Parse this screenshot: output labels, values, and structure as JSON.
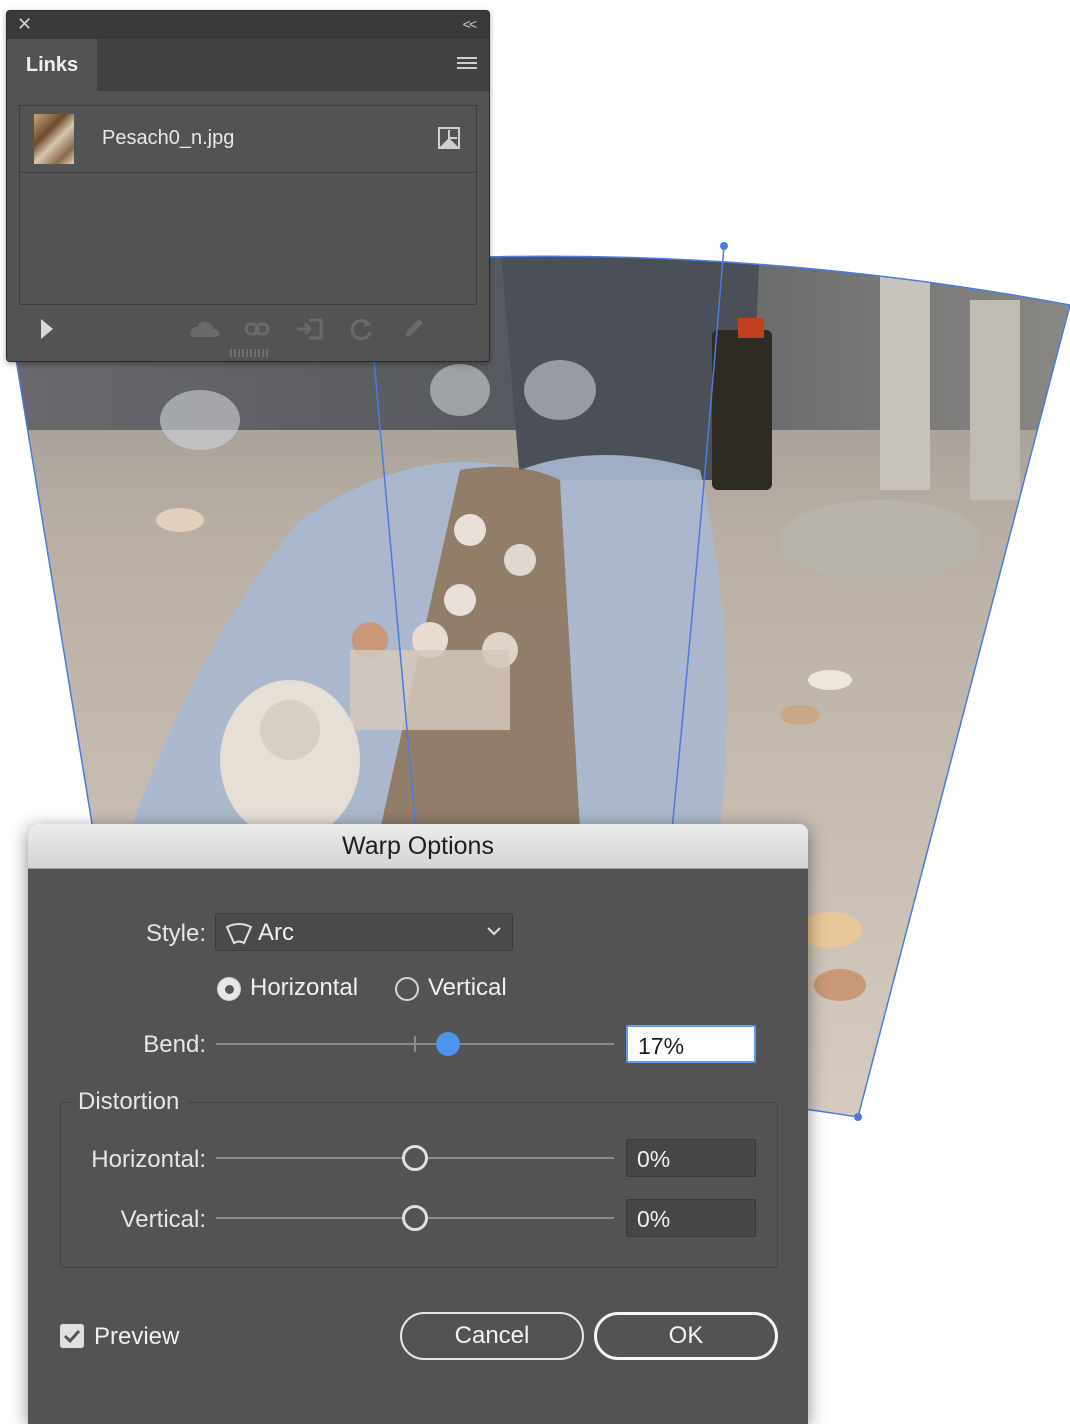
{
  "links_panel": {
    "close_glyph": "✕",
    "collapse_glyph": "<<",
    "tab_label": "Links",
    "items": [
      {
        "filename": "Pesach0_n.jpg"
      }
    ],
    "footer_icons": [
      "play-triangle-icon",
      "cloud-icon",
      "relink-icon",
      "goto-link-icon",
      "update-link-icon",
      "edit-original-icon"
    ]
  },
  "warp_dialog": {
    "title": "Warp Options",
    "style_label": "Style:",
    "style_value": "Arc",
    "orientation": {
      "horizontal_label": "Horizontal",
      "vertical_label": "Vertical",
      "selected": "horizontal"
    },
    "bend": {
      "label": "Bend:",
      "value": "17%",
      "fraction": 0.17
    },
    "distortion": {
      "group_label": "Distortion",
      "horizontal": {
        "label": "Horizontal:",
        "value": "0%"
      },
      "vertical": {
        "label": "Vertical:",
        "value": "0%"
      }
    },
    "preview": {
      "label": "Preview",
      "checked": true
    },
    "cancel_label": "Cancel",
    "ok_label": "OK"
  },
  "colors": {
    "panel_bg": "#535353",
    "selection_blue": "#4b7be0",
    "slider_thumb": "#4b95ee"
  }
}
